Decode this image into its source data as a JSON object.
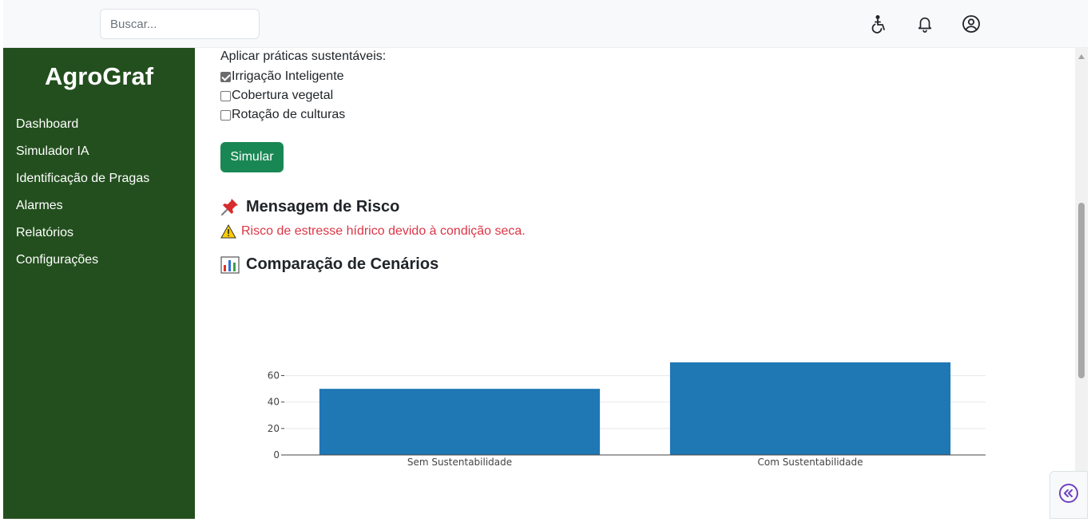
{
  "search": {
    "placeholder": "Buscar..."
  },
  "topbar_icons": [
    "accessibility-icon",
    "bell-icon",
    "user-circle-icon"
  ],
  "sidebar": {
    "brand": "AgroGraf",
    "items": [
      {
        "label": "Dashboard"
      },
      {
        "label": "Simulador IA"
      },
      {
        "label": "Identificação de Pragas"
      },
      {
        "label": "Alarmes"
      },
      {
        "label": "Relatórios"
      },
      {
        "label": "Configurações"
      }
    ]
  },
  "practices": {
    "heading": "Aplicar práticas sustentáveis:",
    "options": [
      {
        "label": "Irrigação Inteligente",
        "checked": true
      },
      {
        "label": "Cobertura vegetal",
        "checked": false
      },
      {
        "label": "Rotação de culturas",
        "checked": false
      }
    ]
  },
  "simulate_button": "Simular",
  "risk_section": {
    "title": "Mensagem de Risco",
    "message": "Risco de estresse hídrico devido à condição seca."
  },
  "comparison_section": {
    "title": "Comparação de Cenários"
  },
  "colors": {
    "sidebar": "#234f1e",
    "button": "#198754",
    "risk": "#dc3545",
    "bar": "#1f77b4",
    "collapse_icon": "#6f42c1"
  },
  "chart_data": {
    "type": "bar",
    "categories": [
      "Sem Sustentabilidade",
      "Com Sustentabilidade"
    ],
    "values": [
      50,
      70
    ],
    "yticks": [
      0,
      20,
      40,
      60
    ],
    "ylim": [
      0,
      70
    ],
    "grid": true,
    "title": "",
    "xlabel": "",
    "ylabel": ""
  }
}
